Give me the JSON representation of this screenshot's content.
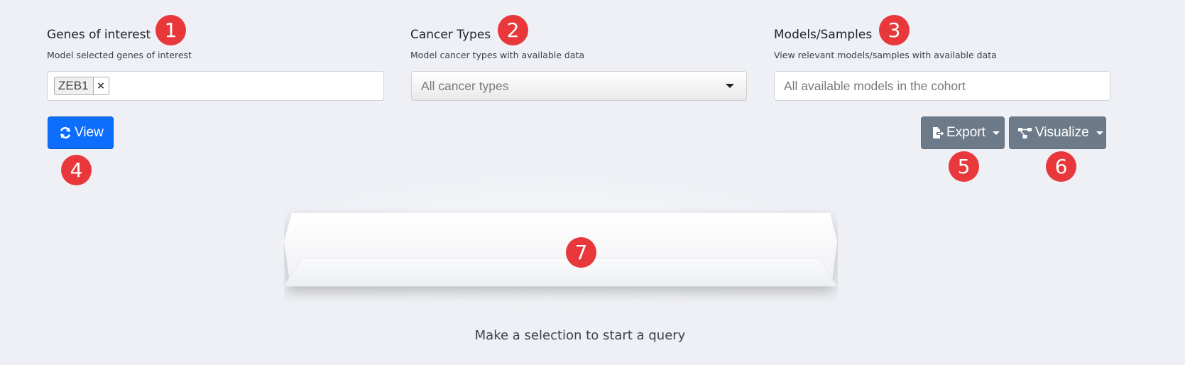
{
  "genes": {
    "title": "Genes of interest",
    "subtitle": "Model selected genes of interest",
    "selected_tags": [
      "ZEB1"
    ],
    "remove_symbol": "×"
  },
  "cancer_types": {
    "title": "Cancer Types",
    "subtitle": "Model cancer types with available data",
    "placeholder": "All cancer types"
  },
  "models": {
    "title": "Models/Samples",
    "subtitle": "View relevant models/samples with available data",
    "placeholder": "All available models in the cohort"
  },
  "toolbar": {
    "view_label": "View",
    "export_label": "Export",
    "visualize_label": "Visualize"
  },
  "empty_state": {
    "message": "Make a selection to start a query"
  },
  "badges": {
    "b1": "1",
    "b2": "2",
    "b3": "3",
    "b4": "4",
    "b5": "5",
    "b6": "6",
    "b7": "7"
  },
  "icons": {
    "view": "refresh-icon",
    "export": "file-export-icon",
    "visualize": "network-icon"
  },
  "colors": {
    "primary_button": "#0d6efd",
    "secondary_button": "#6c7a89",
    "badge": "#e8383b",
    "background": "#eef0f5"
  }
}
